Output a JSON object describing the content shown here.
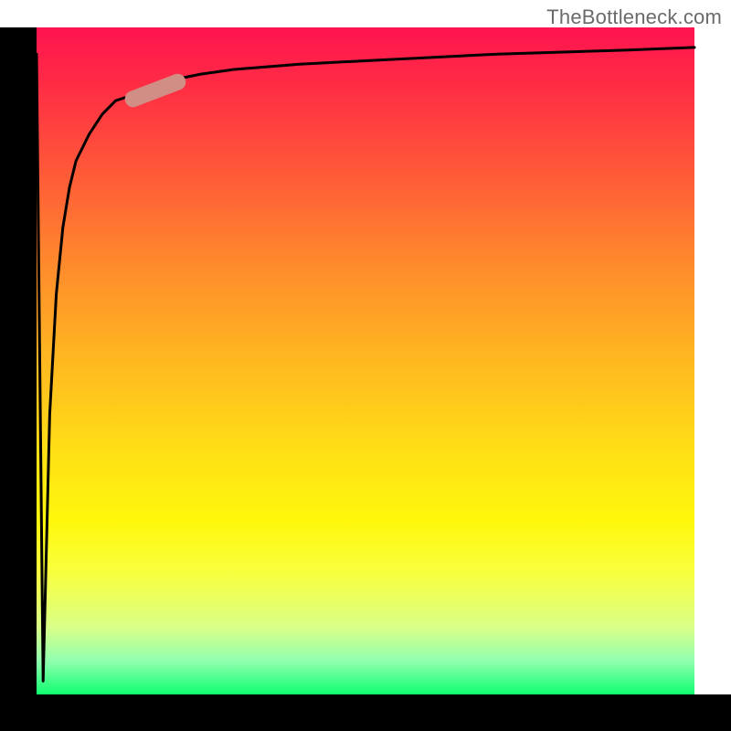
{
  "attribution": "TheBottleneck.com",
  "colors": {
    "axis": "#000000",
    "curve": "#000000",
    "highlight": "#d08e85",
    "gradient_top": "#ff1450",
    "gradient_bottom": "#10ff70"
  },
  "chart_data": {
    "type": "line",
    "title": "",
    "xlabel": "",
    "ylabel": "",
    "xlim": [
      0,
      100
    ],
    "ylim": [
      0,
      100
    ],
    "x": [
      0,
      1,
      2,
      3,
      4,
      5,
      6,
      8,
      10,
      12,
      15,
      20,
      25,
      30,
      40,
      50,
      60,
      70,
      80,
      90,
      100
    ],
    "y": [
      96,
      2,
      42,
      60,
      70,
      76,
      80,
      84,
      87,
      89,
      90,
      92,
      93,
      93.7,
      94.5,
      95,
      95.5,
      96,
      96.3,
      96.6,
      97
    ],
    "highlight_segment": {
      "x_start": 14,
      "x_end": 22,
      "y_start": 89,
      "y_end": 92
    },
    "annotations": []
  }
}
